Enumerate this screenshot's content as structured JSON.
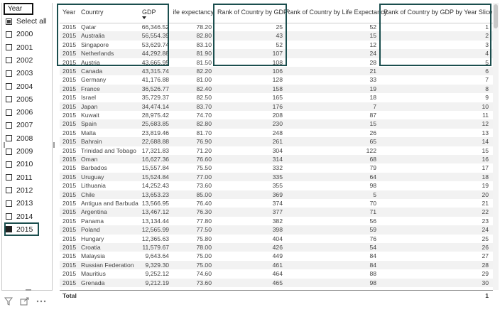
{
  "slicer": {
    "title": "Year",
    "items": [
      {
        "label": "Select all",
        "state": "partial"
      },
      {
        "label": "2000",
        "state": "off"
      },
      {
        "label": "2001",
        "state": "off"
      },
      {
        "label": "2002",
        "state": "off"
      },
      {
        "label": "2003",
        "state": "off"
      },
      {
        "label": "2004",
        "state": "off"
      },
      {
        "label": "2005",
        "state": "off"
      },
      {
        "label": "2006",
        "state": "off"
      },
      {
        "label": "2007",
        "state": "off"
      },
      {
        "label": "2008",
        "state": "off"
      },
      {
        "label": "2009",
        "state": "off"
      },
      {
        "label": "2010",
        "state": "off"
      },
      {
        "label": "2011",
        "state": "off"
      },
      {
        "label": "2012",
        "state": "off"
      },
      {
        "label": "2013",
        "state": "off"
      },
      {
        "label": "2014",
        "state": "off"
      },
      {
        "label": "2015",
        "state": "checked"
      }
    ]
  },
  "table": {
    "headers": {
      "year": "Year",
      "country": "Country",
      "gdp": "GDP",
      "life": "Life expectancy",
      "rank_gdp": "Rank of Country by GDP",
      "rank_life": "Rank of Country by Life Expectancy",
      "rank_slicer": "Rank of Country by GDP by Year Slicer"
    },
    "rows": [
      [
        "2015",
        "Qatar",
        "66,346.52",
        "78.20",
        "25",
        "52",
        "1"
      ],
      [
        "2015",
        "Australia",
        "56,554.39",
        "82.80",
        "43",
        "15",
        "2"
      ],
      [
        "2015",
        "Singapore",
        "53,629.74",
        "83.10",
        "52",
        "12",
        "3"
      ],
      [
        "2015",
        "Netherlands",
        "44,292.88",
        "81.90",
        "107",
        "24",
        "4"
      ],
      [
        "2015",
        "Austria",
        "43,665.95",
        "81.50",
        "108",
        "28",
        "5"
      ],
      [
        "2015",
        "Canada",
        "43,315.74",
        "82.20",
        "106",
        "21",
        "6"
      ],
      [
        "2015",
        "Germany",
        "41,176.88",
        "81.00",
        "128",
        "33",
        "7"
      ],
      [
        "2015",
        "France",
        "36,526.77",
        "82.40",
        "158",
        "19",
        "8"
      ],
      [
        "2015",
        "Israel",
        "35,729.37",
        "82.50",
        "165",
        "18",
        "9"
      ],
      [
        "2015",
        "Japan",
        "34,474.14",
        "83.70",
        "176",
        "7",
        "10"
      ],
      [
        "2015",
        "Kuwait",
        "28,975.42",
        "74.70",
        "208",
        "87",
        "11"
      ],
      [
        "2015",
        "Spain",
        "25,683.85",
        "82.80",
        "230",
        "15",
        "12"
      ],
      [
        "2015",
        "Malta",
        "23,819.46",
        "81.70",
        "248",
        "26",
        "13"
      ],
      [
        "2015",
        "Bahrain",
        "22,688.88",
        "76.90",
        "261",
        "65",
        "14"
      ],
      [
        "2015",
        "Trinidad and Tobago",
        "17,321.83",
        "71.20",
        "304",
        "122",
        "15"
      ],
      [
        "2015",
        "Oman",
        "16,627.36",
        "76.60",
        "314",
        "68",
        "16"
      ],
      [
        "2015",
        "Barbados",
        "15,557.84",
        "75.50",
        "332",
        "79",
        "17"
      ],
      [
        "2015",
        "Uruguay",
        "15,524.84",
        "77.00",
        "335",
        "64",
        "18"
      ],
      [
        "2015",
        "Lithuania",
        "14,252.43",
        "73.60",
        "355",
        "98",
        "19"
      ],
      [
        "2015",
        "Chile",
        "13,653.23",
        "85.00",
        "369",
        "5",
        "20"
      ],
      [
        "2015",
        "Antigua and Barbuda",
        "13,566.95",
        "76.40",
        "374",
        "70",
        "21"
      ],
      [
        "2015",
        "Argentina",
        "13,467.12",
        "76.30",
        "377",
        "71",
        "22"
      ],
      [
        "2015",
        "Panama",
        "13,134.44",
        "77.80",
        "382",
        "56",
        "23"
      ],
      [
        "2015",
        "Poland",
        "12,565.99",
        "77.50",
        "398",
        "59",
        "24"
      ],
      [
        "2015",
        "Hungary",
        "12,365.63",
        "75.80",
        "404",
        "76",
        "25"
      ],
      [
        "2015",
        "Croatia",
        "11,579.67",
        "78.00",
        "426",
        "54",
        "26"
      ],
      [
        "2015",
        "Malaysia",
        "9,643.64",
        "75.00",
        "449",
        "84",
        "27"
      ],
      [
        "2015",
        "Russian Federation",
        "9,329.30",
        "75.00",
        "461",
        "84",
        "28"
      ],
      [
        "2015",
        "Mauritius",
        "9,252.12",
        "74.60",
        "464",
        "88",
        "29"
      ],
      [
        "2015",
        "Grenada",
        "9,212.19",
        "73.60",
        "465",
        "98",
        "30"
      ]
    ],
    "total_label": "Total",
    "total_value": "1"
  },
  "icons": [
    "filter-icon",
    "focus-mode-icon",
    "more-options-icon"
  ]
}
